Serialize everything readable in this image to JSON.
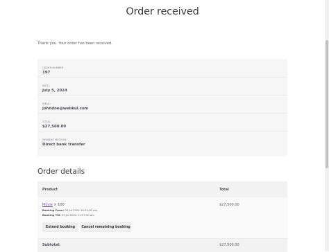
{
  "page": {
    "title": "Order received"
  },
  "notice": {
    "text": "Thank you. Your order has been received."
  },
  "overview": {
    "items": [
      {
        "label": "ORDER NUMBER",
        "value": "197"
      },
      {
        "label": "DATE:",
        "value": "July 5, 2024"
      },
      {
        "label": "EMAIL:",
        "value": "johndoe@webkul.com"
      },
      {
        "label": "TOTAL:",
        "value": "$27,500.00"
      },
      {
        "label": "PAYMENT METHOD:",
        "value": "Direct bank transfer"
      }
    ]
  },
  "order_details": {
    "title": "Order details",
    "headers": {
      "product": "Product",
      "total": "Total"
    },
    "item": {
      "name": "Movie",
      "quantity": "× 100",
      "booking_from_label": "Booking From:",
      "booking_from": "05 Jul 2024 10:22:00 am",
      "booking_till_label": "Booking Till:",
      "booking_till": "05 Jul 2024 11:57:00 am",
      "total": "$27,500.00",
      "buttons": {
        "extend": "Extend booking",
        "cancel": "Cancel remaining booking"
      }
    },
    "subtotal": {
      "label": "Subtotal:",
      "value": "$27,500.00"
    }
  }
}
